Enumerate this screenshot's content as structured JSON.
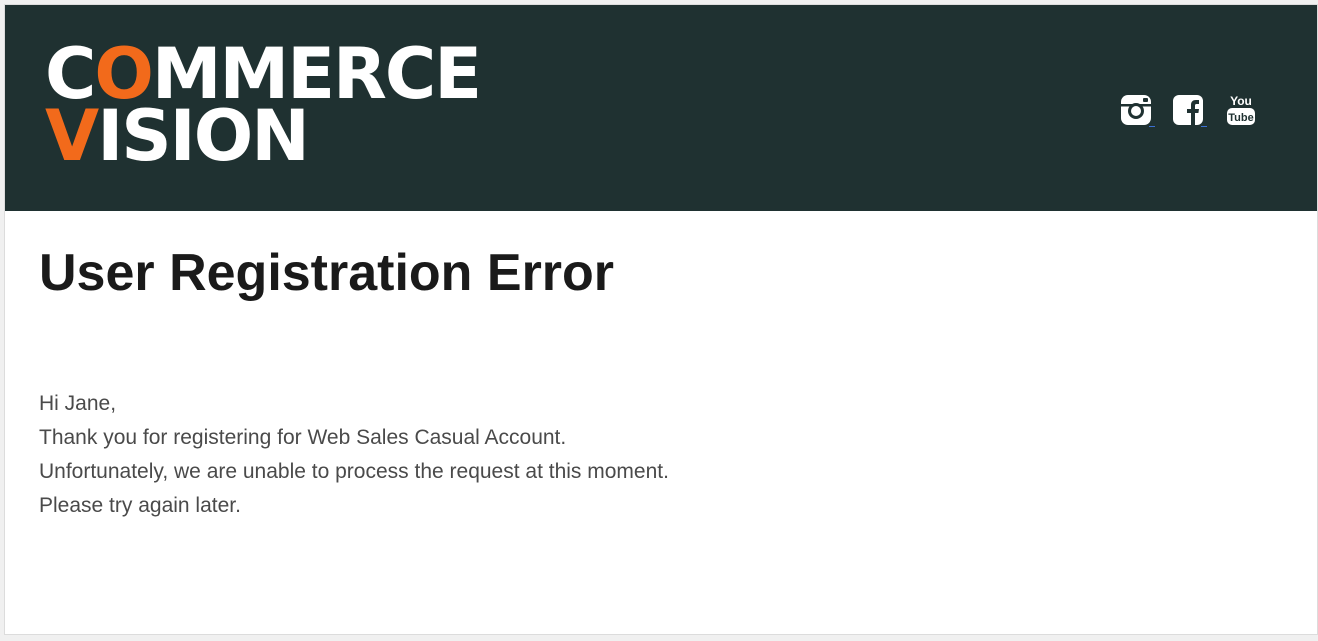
{
  "brand": {
    "logo_line1_pre": "C",
    "logo_line1_accent": "O",
    "logo_line1_post": "MMERCE",
    "logo_line2_accent": "V",
    "logo_line2_post": "ISION",
    "accent_color": "#f26a1b",
    "header_bg": "#1f3131"
  },
  "social": [
    {
      "name": "instagram",
      "icon": "instagram-icon"
    },
    {
      "name": "facebook",
      "icon": "facebook-icon"
    },
    {
      "name": "youtube",
      "icon": "youtube-icon",
      "icon_text_top": "You",
      "icon_text_bottom": "Tube"
    }
  ],
  "page": {
    "title": "User Registration Error"
  },
  "message": {
    "greeting": "Hi Jane,",
    "line1": "Thank you for registering for Web Sales Casual Account.",
    "line2": "Unfortunately, we are unable to process the request at this moment.",
    "line3": "Please try again later."
  }
}
